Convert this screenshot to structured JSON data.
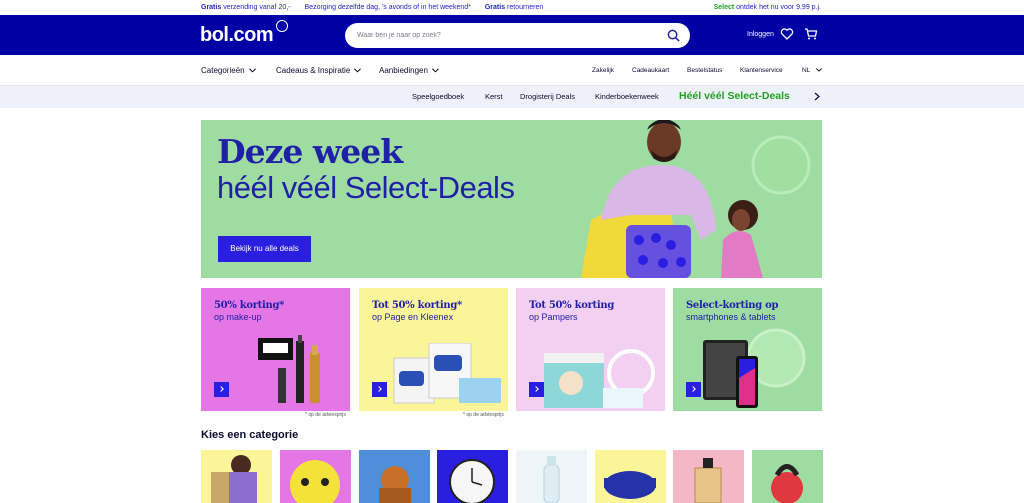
{
  "usp": {
    "item1_bold": "Gratis",
    "item1_rest": "verzending vanaf 20,-",
    "item2": "Bezorging dezelfde dag, 's avonds of in het weekend*",
    "item3_bold": "Gratis",
    "item3_rest": "retourneren",
    "select_bold": "Select",
    "select_rest": "ontdek het nu voor 9,99 p.j."
  },
  "header": {
    "logo": "bol.com",
    "search_placeholder": "Waar ben je naar op zoek?",
    "login": "Inloggen"
  },
  "nav": {
    "categories": "Categorieën",
    "gifts": "Cadeaus & Inspiratie",
    "offers": "Aanbiedingen",
    "business": "Zakelijk",
    "giftcard": "Cadeaukaart",
    "order_status": "Bestelstatus",
    "service": "Klantenservice",
    "language": "NL"
  },
  "quick_links": {
    "items": [
      "Speelgoedboek",
      "Kerst",
      "Drogisterij Deals",
      "Kinderboekenweek"
    ],
    "highlight": "Héél véél Select-Deals"
  },
  "hero": {
    "title": "Deze week",
    "subtitle": "héél véél Select-Deals",
    "button": "Bekijk nu alle deals"
  },
  "tiles": [
    {
      "title": "50% korting*",
      "subtitle": "op make-up",
      "bg": "#e476e6"
    },
    {
      "title": "Tot 50% korting*",
      "subtitle": "op Page en Kleenex",
      "bg": "#fbf59a"
    },
    {
      "title": "Tot 50% korting",
      "subtitle": "op Pampers",
      "bg": "#f3d0f2"
    },
    {
      "title": "Select-korting op",
      "subtitle": "smartphones & tablets",
      "bg": "#9fdca1"
    }
  ],
  "notes": {
    "note1": "* op de adviesprijs",
    "note2": "* op de adviesprijs"
  },
  "categories_title": "Kies een categorie",
  "colors": {
    "brand_blue": "#0000a4",
    "select_green": "#23a022",
    "button_blue": "#2a1ee0"
  }
}
